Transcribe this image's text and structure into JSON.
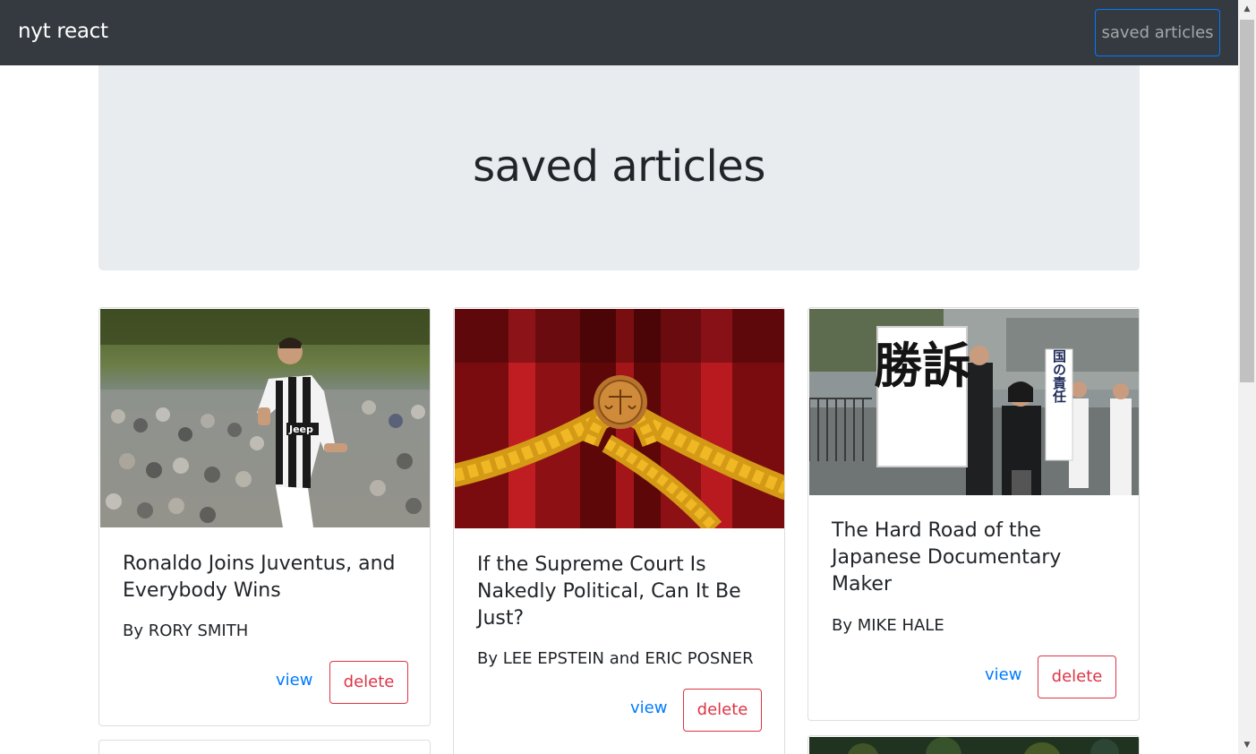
{
  "navbar": {
    "brand": "nyt react",
    "saved_button": "saved articles"
  },
  "jumbotron": {
    "title": "saved articles"
  },
  "articles": [
    {
      "title": "Ronaldo Joins Juventus, and Everybody Wins",
      "byline": "By RORY SMITH",
      "view_label": "view",
      "delete_label": "delete"
    },
    {
      "title": "If the Supreme Court Is Nakedly Political, Can It Be Just?",
      "byline": "By LEE EPSTEIN and ERIC POSNER",
      "view_label": "view",
      "delete_label": "delete"
    },
    {
      "title": "The Hard Road of the Japanese Documentary Maker",
      "byline": "By MIKE HALE",
      "view_label": "view",
      "delete_label": "delete",
      "sign_text_large": "勝訴",
      "sign_text_small": "国の責任"
    }
  ]
}
